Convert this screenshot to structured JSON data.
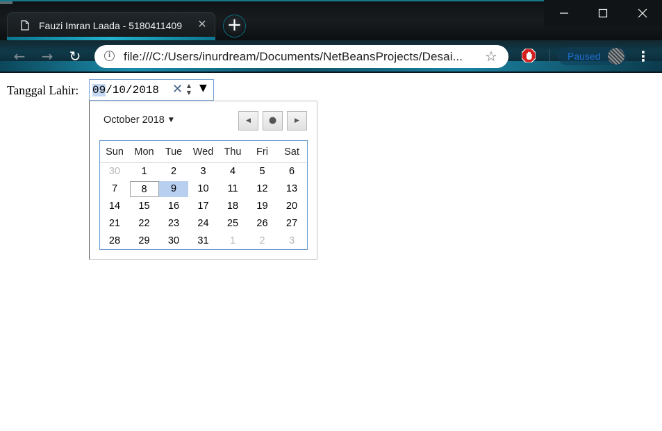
{
  "browser": {
    "tab_title": "Fauzi Imran Laada - 5180411409",
    "tab_close": "✕",
    "new_tab": "+",
    "url": "file:///C:/Users/inurdream/Documents/NetBeansProjects/Desai...",
    "profile_status": "Paused",
    "icons": {
      "back": "←",
      "forward": "→",
      "reload": "↻",
      "info": "i",
      "star": "☆",
      "menu": "⋮",
      "minimize": "—",
      "maximize": "☐",
      "close": "✕"
    }
  },
  "form": {
    "label": "Tanggal Lahir:",
    "date_month": "09",
    "date_rest": "/10/2018",
    "clear": "✕",
    "spin_up": "▲",
    "spin_down": "▼",
    "dropdown": "▼"
  },
  "picker": {
    "month_label": "October 2018",
    "caret": "▼",
    "prev": "◀",
    "today": "●",
    "next": "▶",
    "weekdays": [
      "Sun",
      "Mon",
      "Tue",
      "Wed",
      "Thu",
      "Fri",
      "Sat"
    ],
    "weeks": [
      [
        "30",
        "1",
        "2",
        "3",
        "4",
        "5",
        "6"
      ],
      [
        "7",
        "8",
        "9",
        "10",
        "11",
        "12",
        "13"
      ],
      [
        "14",
        "15",
        "16",
        "17",
        "18",
        "19",
        "20"
      ],
      [
        "21",
        "22",
        "23",
        "24",
        "25",
        "26",
        "27"
      ],
      [
        "28",
        "29",
        "30",
        "31",
        "1",
        "2",
        "3"
      ]
    ],
    "today_day": "8",
    "selected_day": "9"
  },
  "colors": {
    "accent": "#1aa7c0",
    "selected_day_bg": "#b9cff0",
    "input_border": "#7aa2d6",
    "paused_text": "#1f6fd1",
    "stop_sign": "#d31f1f"
  }
}
